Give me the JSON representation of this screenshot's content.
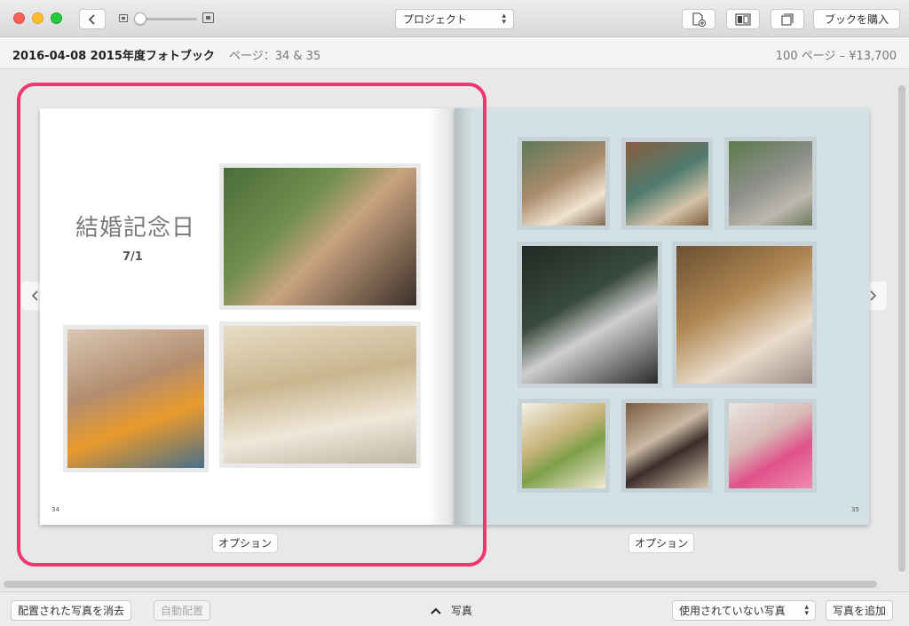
{
  "toolbar": {
    "project_select": "プロジェクト",
    "buy_button": "ブックを購入",
    "back_icon": "chevron-left-icon",
    "icon_add_page": "add-page-icon",
    "icon_layout": "layout-icon",
    "icon_pages": "pages-icon"
  },
  "infobar": {
    "title": "2016-04-08 2015年度フォトブック",
    "pages": "ページ：34 & 35",
    "price": "100 ページ – ¥13,700"
  },
  "spread": {
    "left": {
      "heading": "結婚記念日",
      "date": "7/1",
      "page_number": "34",
      "options_label": "オプション"
    },
    "right": {
      "page_number": "35",
      "options_label": "オプション"
    }
  },
  "bottombar": {
    "clear_button": "配置された写真を消去",
    "auto_button": "自動配置",
    "photos_toggle": "写真",
    "unused_select": "使用されていない写真",
    "add_button": "写真を追加"
  },
  "colors": {
    "selection": "#f0366e",
    "right_page_bg": "#d4e1e4"
  }
}
